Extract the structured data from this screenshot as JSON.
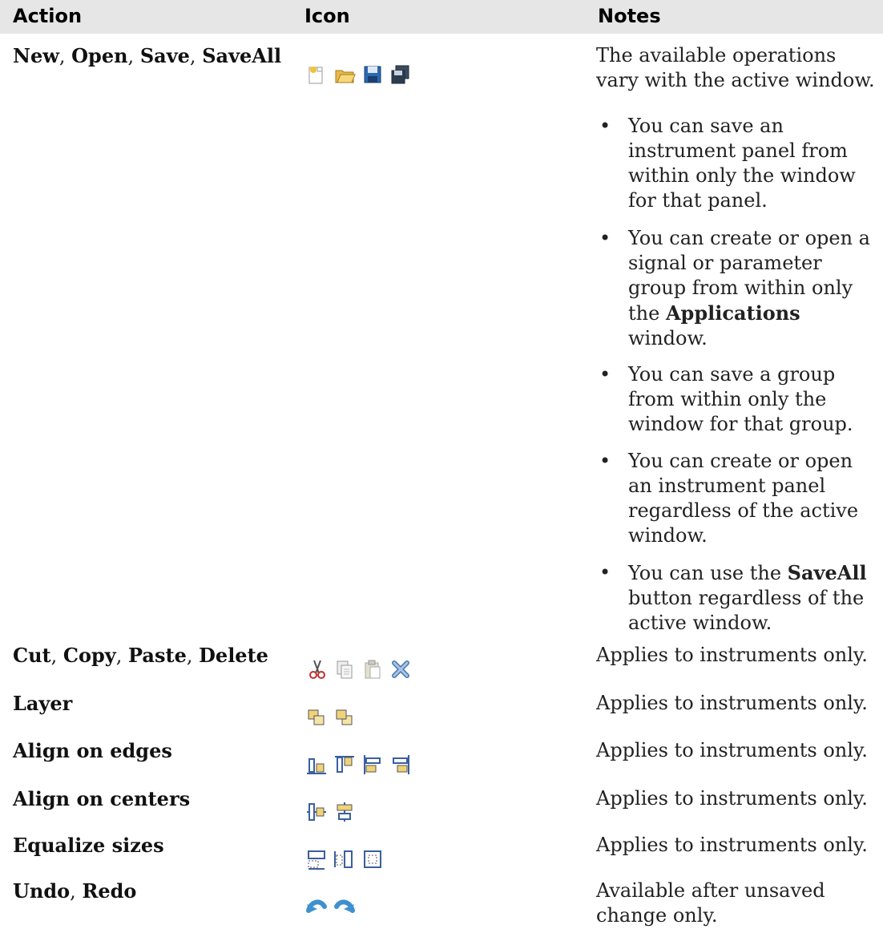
{
  "header": {
    "action": "Action",
    "icon": "Icon",
    "notes": "Notes"
  },
  "rows": [
    {
      "action": [
        {
          "t": "New",
          "b": true
        },
        {
          "t": ", "
        },
        {
          "t": "Open",
          "b": true
        },
        {
          "t": ", "
        },
        {
          "t": "Save",
          "b": true
        },
        {
          "t": ", "
        },
        {
          "t": "SaveAll",
          "b": true
        }
      ],
      "icons": [
        "new-file-icon",
        "open-folder-icon",
        "save-icon",
        "save-all-icon"
      ],
      "note": "The available operations vary with the active window.",
      "bullets": [
        [
          {
            "t": "You can save an instrument panel from within only the window for that panel."
          }
        ],
        [
          {
            "t": "You can create or open a signal or parameter group from within only the "
          },
          {
            "t": "Applications",
            "b": true
          },
          {
            "t": " window."
          }
        ],
        [
          {
            "t": "You can save a group from within only the window for that group."
          }
        ],
        [
          {
            "t": "You can create or open an instrument panel regardless of the active window."
          }
        ],
        [
          {
            "t": "You can use the "
          },
          {
            "t": "SaveAll",
            "b": true
          },
          {
            "t": " button regardless of the active window."
          }
        ]
      ]
    },
    {
      "action": [
        {
          "t": "Cut",
          "b": true
        },
        {
          "t": ", "
        },
        {
          "t": "Copy",
          "b": true
        },
        {
          "t": ", "
        },
        {
          "t": "Paste",
          "b": true
        },
        {
          "t": ", "
        },
        {
          "t": "Delete",
          "b": true
        }
      ],
      "icons": [
        "cut-icon",
        "copy-icon",
        "paste-icon",
        "delete-icon"
      ],
      "note": "Applies to instruments only."
    },
    {
      "action": [
        {
          "t": "Layer",
          "b": true
        }
      ],
      "icons": [
        "bring-to-front-icon",
        "send-to-back-icon"
      ],
      "note": "Applies to instruments only."
    },
    {
      "action": [
        {
          "t": "Align on edges",
          "b": true
        }
      ],
      "icons": [
        "align-bottom-icon",
        "align-top-icon",
        "align-left-icon",
        "align-right-icon"
      ],
      "note": "Applies to instruments only."
    },
    {
      "action": [
        {
          "t": "Align on centers",
          "b": true
        }
      ],
      "icons": [
        "align-vertical-center-icon",
        "align-horizontal-center-icon"
      ],
      "note": "Applies to instruments only."
    },
    {
      "action": [
        {
          "t": "Equalize sizes",
          "b": true
        }
      ],
      "icons": [
        "equalize-width-icon",
        "equalize-height-icon",
        "equalize-size-icon"
      ],
      "note": "Applies to instruments only."
    },
    {
      "action": [
        {
          "t": "Undo",
          "b": true
        },
        {
          "t": ", "
        },
        {
          "t": "Redo",
          "b": true
        }
      ],
      "icons": [
        "undo-icon",
        "redo-icon"
      ],
      "note": "Available after unsaved change only."
    }
  ]
}
